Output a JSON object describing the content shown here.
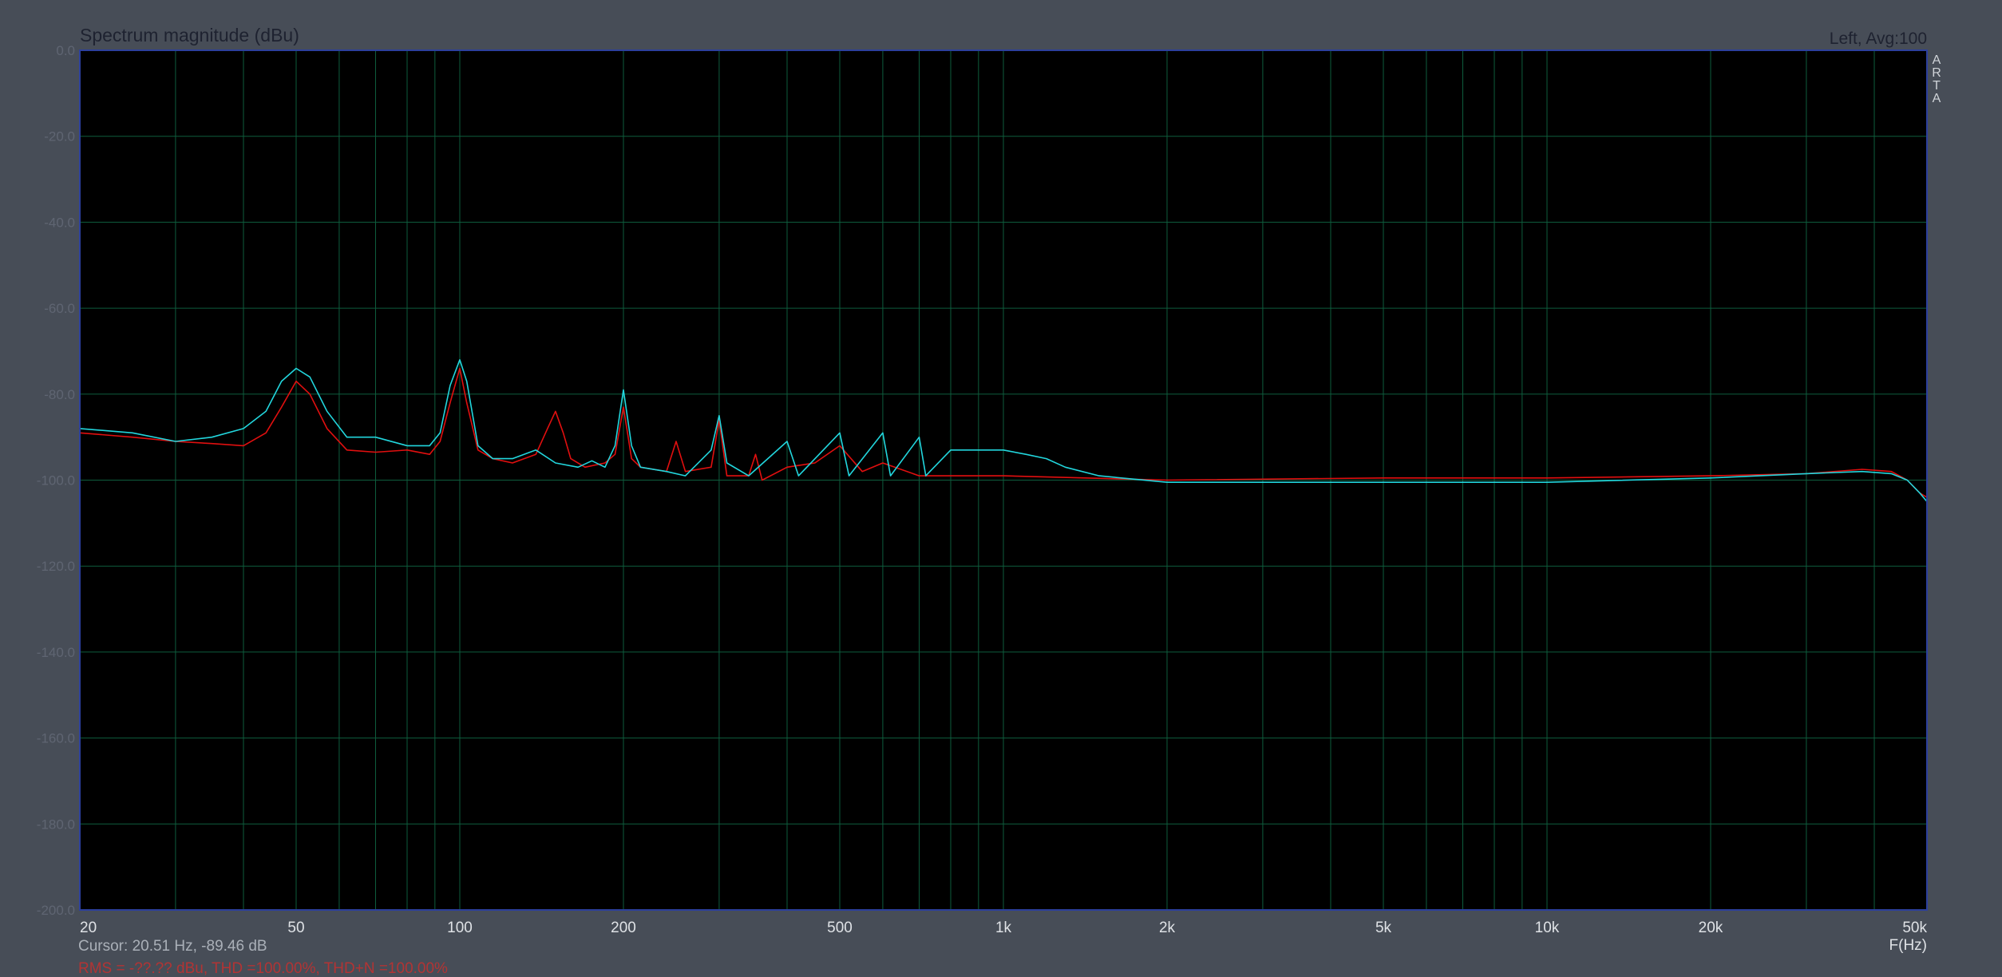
{
  "window": {
    "title": "Spectrum magnitude (dBu)",
    "channel_status": "Left, Avg:100",
    "side_label": "ARTA"
  },
  "footer": {
    "cursor_readout": "Cursor: 20.51 Hz, -89.46 dB",
    "rms_readout": "RMS = -??.?? dBu, THD =100.00%, THD+N =100.00%"
  },
  "colors": {
    "background": "#474d57",
    "plot_area": "#000000",
    "grid": "#0e5d3d",
    "frame": "#2c3f9c",
    "series_red": "#e10f0f",
    "series_cyan": "#22d6dd"
  },
  "chart_data": {
    "type": "line",
    "title": "Spectrum magnitude (dBu)",
    "xlabel": "F(Hz)",
    "ylabel": "",
    "x_scale": "log",
    "xlim": [
      20,
      50000
    ],
    "ylim": [
      -200,
      0
    ],
    "grid": true,
    "x_ticks": [
      {
        "value": 20,
        "label": "20"
      },
      {
        "value": 50,
        "label": "50"
      },
      {
        "value": 100,
        "label": "100"
      },
      {
        "value": 200,
        "label": "200"
      },
      {
        "value": 500,
        "label": "500"
      },
      {
        "value": 1000,
        "label": "1k"
      },
      {
        "value": 2000,
        "label": "2k"
      },
      {
        "value": 5000,
        "label": "5k"
      },
      {
        "value": 10000,
        "label": "10k"
      },
      {
        "value": 20000,
        "label": "20k"
      },
      {
        "value": 50000,
        "label": "50k"
      }
    ],
    "y_ticks": [
      {
        "value": 0,
        "label": "0.0"
      },
      {
        "value": -20,
        "label": "-20.0"
      },
      {
        "value": -40,
        "label": "-40.0"
      },
      {
        "value": -60,
        "label": "-60.0"
      },
      {
        "value": -80,
        "label": "-80.0"
      },
      {
        "value": -100,
        "label": "-100.0"
      },
      {
        "value": -120,
        "label": "-120.0"
      },
      {
        "value": -140,
        "label": "-140.0"
      },
      {
        "value": -160,
        "label": "-160.0"
      },
      {
        "value": -180,
        "label": "-180.0"
      },
      {
        "value": -200,
        "label": "-200.0"
      }
    ],
    "series": [
      {
        "color": "#e10f0f",
        "points": [
          [
            20,
            -89
          ],
          [
            25,
            -90
          ],
          [
            30,
            -91
          ],
          [
            35,
            -91.5
          ],
          [
            40,
            -92
          ],
          [
            44,
            -89
          ],
          [
            47,
            -83
          ],
          [
            50,
            -77
          ],
          [
            53,
            -80
          ],
          [
            57,
            -88
          ],
          [
            62,
            -93
          ],
          [
            70,
            -93.5
          ],
          [
            80,
            -93
          ],
          [
            88,
            -94
          ],
          [
            92,
            -91
          ],
          [
            96,
            -82
          ],
          [
            100,
            -74
          ],
          [
            103,
            -82
          ],
          [
            108,
            -93
          ],
          [
            115,
            -95
          ],
          [
            125,
            -96
          ],
          [
            138,
            -94
          ],
          [
            145,
            -88
          ],
          [
            150,
            -84
          ],
          [
            155,
            -89
          ],
          [
            160,
            -95
          ],
          [
            170,
            -97
          ],
          [
            185,
            -96
          ],
          [
            193,
            -94
          ],
          [
            200,
            -83
          ],
          [
            207,
            -95
          ],
          [
            215,
            -97
          ],
          [
            240,
            -98
          ],
          [
            250,
            -91
          ],
          [
            260,
            -98
          ],
          [
            290,
            -97
          ],
          [
            300,
            -86
          ],
          [
            310,
            -99
          ],
          [
            340,
            -99
          ],
          [
            350,
            -94
          ],
          [
            360,
            -100
          ],
          [
            400,
            -97
          ],
          [
            450,
            -96
          ],
          [
            500,
            -92
          ],
          [
            550,
            -98
          ],
          [
            600,
            -96
          ],
          [
            700,
            -99
          ],
          [
            1000,
            -99
          ],
          [
            2000,
            -100
          ],
          [
            5000,
            -99.5
          ],
          [
            10000,
            -99.5
          ],
          [
            20000,
            -99
          ],
          [
            30000,
            -98.5
          ],
          [
            38000,
            -97.5
          ],
          [
            43000,
            -98
          ],
          [
            46000,
            -100
          ],
          [
            48500,
            -103
          ],
          [
            50000,
            -104
          ]
        ]
      },
      {
        "color": "#22d6dd",
        "points": [
          [
            20,
            -88
          ],
          [
            25,
            -89
          ],
          [
            30,
            -91
          ],
          [
            35,
            -90
          ],
          [
            40,
            -88
          ],
          [
            44,
            -84
          ],
          [
            47,
            -77
          ],
          [
            50,
            -74
          ],
          [
            53,
            -76
          ],
          [
            57,
            -84
          ],
          [
            62,
            -90
          ],
          [
            70,
            -90
          ],
          [
            80,
            -92
          ],
          [
            88,
            -92
          ],
          [
            92,
            -89
          ],
          [
            96,
            -78
          ],
          [
            100,
            -72
          ],
          [
            103,
            -77
          ],
          [
            108,
            -92
          ],
          [
            115,
            -95
          ],
          [
            125,
            -95
          ],
          [
            138,
            -93
          ],
          [
            150,
            -96
          ],
          [
            165,
            -97
          ],
          [
            175,
            -95.5
          ],
          [
            185,
            -97
          ],
          [
            193,
            -92
          ],
          [
            200,
            -79
          ],
          [
            207,
            -92
          ],
          [
            215,
            -97
          ],
          [
            240,
            -98
          ],
          [
            260,
            -99
          ],
          [
            290,
            -93
          ],
          [
            300,
            -85
          ],
          [
            310,
            -96
          ],
          [
            340,
            -99
          ],
          [
            400,
            -91
          ],
          [
            420,
            -99
          ],
          [
            500,
            -89
          ],
          [
            520,
            -99
          ],
          [
            600,
            -89
          ],
          [
            620,
            -99
          ],
          [
            700,
            -90
          ],
          [
            720,
            -99
          ],
          [
            800,
            -93
          ],
          [
            900,
            -93
          ],
          [
            1000,
            -93
          ],
          [
            1100,
            -94
          ],
          [
            1200,
            -95
          ],
          [
            1300,
            -97
          ],
          [
            1500,
            -99
          ],
          [
            2000,
            -100.5
          ],
          [
            5000,
            -100.5
          ],
          [
            10000,
            -100.5
          ],
          [
            20000,
            -99.5
          ],
          [
            30000,
            -98.5
          ],
          [
            38000,
            -98
          ],
          [
            43000,
            -98.5
          ],
          [
            46000,
            -100
          ],
          [
            48500,
            -103
          ],
          [
            50000,
            -105
          ]
        ]
      }
    ]
  }
}
